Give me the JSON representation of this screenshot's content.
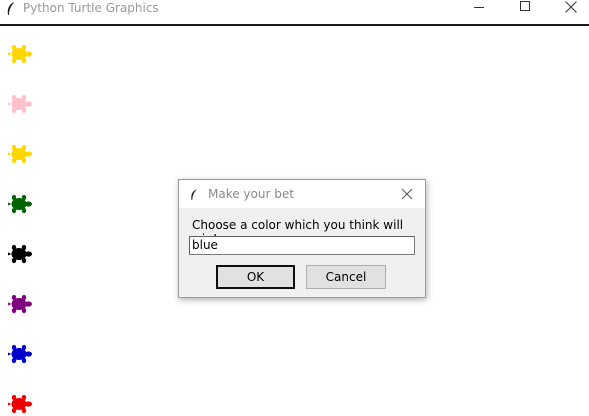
{
  "window": {
    "title": "Python Turtle Graphics",
    "controls": [
      "minimize-icon",
      "maximize-icon",
      "close-icon"
    ]
  },
  "turtles": [
    {
      "color": "#ffd700"
    },
    {
      "color": "#ffc0cb"
    },
    {
      "color": "#ffd700"
    },
    {
      "color": "#006400"
    },
    {
      "color": "#000000"
    },
    {
      "color": "#800080"
    },
    {
      "color": "#0000cd"
    },
    {
      "color": "#ee0000"
    }
  ],
  "dialog": {
    "title": "Make your bet",
    "prompt": "Choose a color which you think will win!",
    "input_value": "blue",
    "ok_label": "OK",
    "cancel_label": "Cancel"
  }
}
